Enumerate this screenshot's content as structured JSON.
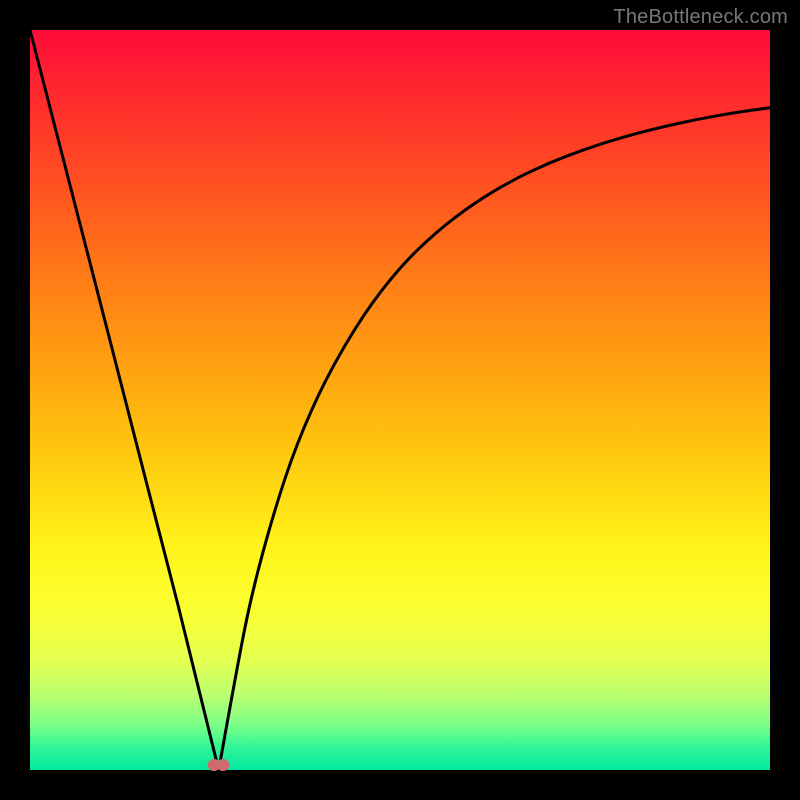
{
  "watermark": "TheBottleneck.com",
  "colors": {
    "frame": "#000000",
    "curve": "#000000",
    "marker": "#ce6b6f",
    "gradient_top": "#ff0a3a",
    "gradient_bottom": "#00e8a0"
  },
  "chart_data": {
    "type": "line",
    "title": "",
    "xlabel": "",
    "ylabel": "",
    "xlim": [
      0,
      100
    ],
    "ylim": [
      0,
      100
    ],
    "description": "Two curve segments meeting at a V-shaped minimum at x≈25.5, overlaid on a vertical red→green gradient. Left segment is near-linear descending from top-left; right segment rises steeply then flattens asymptotically toward the top-right.",
    "series": [
      {
        "name": "left-branch",
        "x": [
          0,
          5,
          10,
          15,
          20,
          25.5
        ],
        "values": [
          100,
          80.6,
          61.2,
          41.7,
          22.3,
          0
        ]
      },
      {
        "name": "right-branch",
        "x": [
          25.5,
          28,
          30,
          33,
          36,
          40,
          45,
          50,
          55,
          60,
          65,
          70,
          75,
          80,
          85,
          90,
          95,
          100
        ],
        "values": [
          0,
          14,
          24,
          35,
          44,
          53,
          61.5,
          68,
          72.8,
          76.6,
          79.6,
          82,
          83.9,
          85.5,
          86.8,
          87.9,
          88.8,
          89.5
        ]
      }
    ],
    "markers": [
      {
        "name": "min-point-a",
        "x": 24.9,
        "y": 0.7
      },
      {
        "name": "min-point-b",
        "x": 26.1,
        "y": 0.7
      }
    ]
  }
}
